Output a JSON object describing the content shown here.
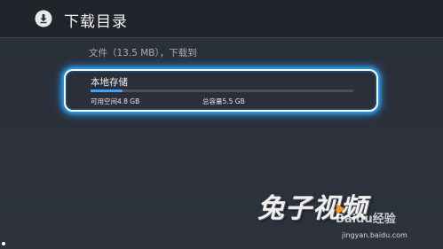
{
  "header": {
    "title": "下载目录",
    "icon": "download-icon"
  },
  "info": {
    "text": "文件（13.5 MB），下载到"
  },
  "storage": {
    "name": "本地存储",
    "free": "可用空间4.8 GB",
    "total": "总容量5.5 GB",
    "used_fraction": 0.12
  },
  "logo": {
    "text": "兔子视频"
  },
  "watermark": {
    "brand": "Baidu经验",
    "url": "jingyan.baidu.com"
  },
  "colors": {
    "accent": "#3ba3ff",
    "glow": "#2aa6ff",
    "header_bg": "#20242b"
  }
}
